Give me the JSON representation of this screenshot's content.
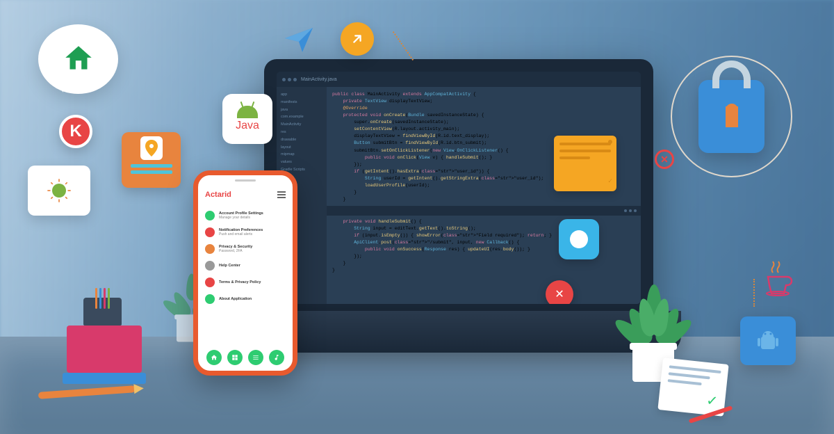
{
  "scene": {
    "description": "Mobile/Java development illustration with laptop IDE, smartphone app mockup and floating tech icons"
  },
  "laptop": {
    "ide": {
      "title": "MainActivity.java",
      "sidebar_items": [
        "app",
        "manifests",
        "java",
        "com.example",
        "MainActivity",
        "res",
        "drawable",
        "layout",
        "mipmap",
        "values",
        "Gradle Scripts"
      ],
      "code_block_1": [
        "public class MainActivity extends AppCompatActivity {",
        "    private TextView displayTextView;",
        "    @Override",
        "    protected void onCreate(Bundle savedInstanceState) {",
        "        super.onCreate(savedInstanceState);",
        "        setContentView(R.layout.activity_main);",
        "        displayTextView = findViewById(R.id.text_display);",
        "        Button submitBtn = findViewById(R.id.btn_submit);",
        "        submitBtn.setOnClickListener(new View.OnClickListener() {",
        "            public void onClick(View v) { handleSubmit(); }",
        "        });",
        "        if (getIntent().hasExtra(\"user_id\")) {",
        "            String userId = getIntent().getStringExtra(\"user_id\");",
        "            loadUserProfile(userId);",
        "        }",
        "    }"
      ],
      "code_block_2": [
        "    private void handleSubmit() {",
        "        String input = editText.getText().toString();",
        "        if (input.isEmpty()) { showError(\"Field required\"); return; }",
        "        ApiClient.post(\"/submit\", input, new Callback() {",
        "            public void onSuccess(Response res) { updateUI(res.body()); }",
        "        });",
        "    }",
        "}"
      ]
    }
  },
  "phone": {
    "app_title": "Actarid",
    "list_items": [
      {
        "title": "Account Profile Settings",
        "subtitle": "Manage your details",
        "color": "#2ecc71"
      },
      {
        "title": "Notification Preferences",
        "subtitle": "Push and email alerts",
        "color": "#e84545"
      },
      {
        "title": "Privacy & Security",
        "subtitle": "Password, 2FA",
        "color": "#e8843e"
      },
      {
        "title": "Help Center",
        "subtitle": "",
        "color": "#999"
      },
      {
        "title": "Terms & Privacy Policy",
        "subtitle": "",
        "color": "#e84545"
      },
      {
        "title": "About Application",
        "subtitle": "",
        "color": "#2ecc71"
      }
    ]
  },
  "badges": {
    "java_label": "Java",
    "k_label": "K"
  }
}
